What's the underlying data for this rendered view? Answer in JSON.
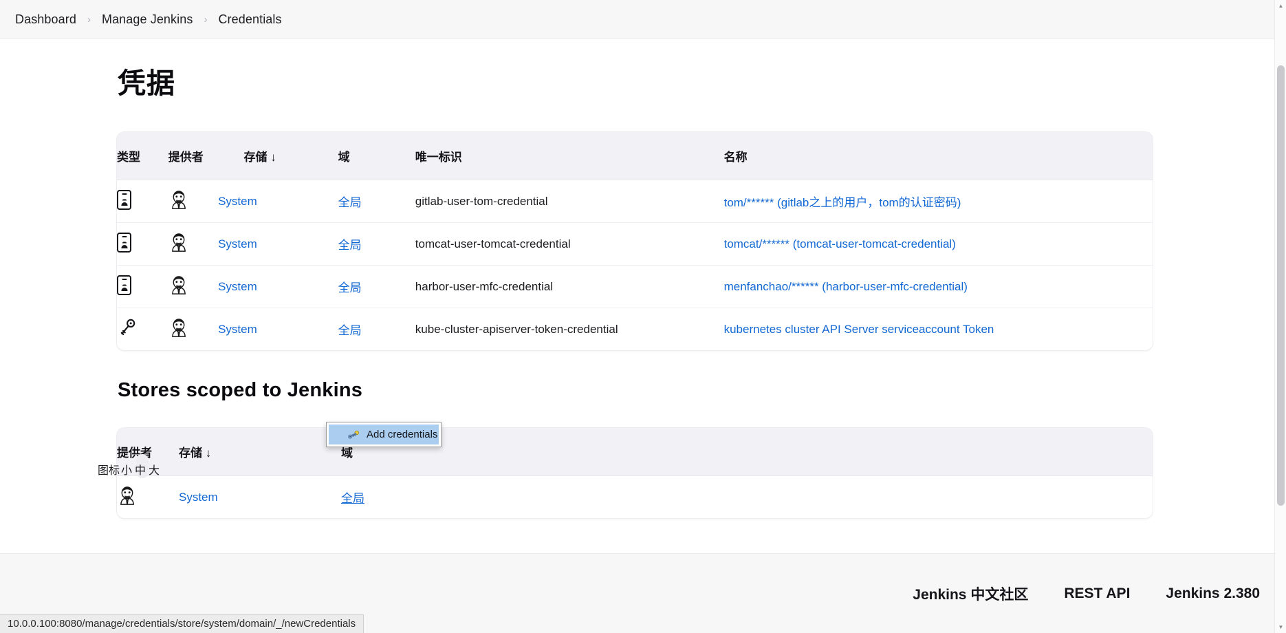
{
  "breadcrumb": {
    "items": [
      "Dashboard",
      "Manage Jenkins",
      "Credentials"
    ],
    "separator": "›"
  },
  "page": {
    "title": "凭据",
    "section_title": "Stores scoped to Jenkins"
  },
  "credentials_table": {
    "headers": {
      "type": "类型",
      "provider": "提供者",
      "store": "存储 ↓",
      "domain": "域",
      "id": "唯一标识",
      "name": "名称"
    },
    "rows": [
      {
        "type_icon": "id-card-icon",
        "provider_icon": "jenkins-butler-icon",
        "store": "System",
        "domain": "全局",
        "id": "gitlab-user-tom-credential",
        "name": "tom/****** (gitlab之上的用户，tom的认证密码)"
      },
      {
        "type_icon": "id-card-icon",
        "provider_icon": "jenkins-butler-icon",
        "store": "System",
        "domain": "全局",
        "id": "tomcat-user-tomcat-credential",
        "name": "tomcat/****** (tomcat-user-tomcat-credential)"
      },
      {
        "type_icon": "id-card-icon",
        "provider_icon": "jenkins-butler-icon",
        "store": "System",
        "domain": "全局",
        "id": "harbor-user-mfc-credential",
        "name": "menfanchao/****** (harbor-user-mfc-credential)"
      },
      {
        "type_icon": "key-icon",
        "provider_icon": "jenkins-butler-icon",
        "store": "System",
        "domain": "全局",
        "id": "kube-cluster-apiserver-token-credential",
        "name": "kubernetes cluster API Server serviceaccount Token"
      }
    ]
  },
  "stores_table": {
    "headers": {
      "provider": "提供者",
      "store": "存储 ↓",
      "domain": "域"
    },
    "rows": [
      {
        "provider_icon": "jenkins-butler-icon",
        "store": "System",
        "domain": "全局"
      }
    ]
  },
  "dropdown": {
    "visible": true,
    "items": [
      {
        "label": "Add credentials",
        "icon": "key-icon",
        "highlighted": true
      }
    ]
  },
  "icon_size": {
    "label": "图标",
    "options": [
      "小",
      "中",
      "大"
    ],
    "selected": "中"
  },
  "status_bar": {
    "url": "10.0.0.100:8080/manage/credentials/store/system/domain/_/newCredentials"
  },
  "footer": {
    "links": [
      "Jenkins 中文社区",
      "REST API",
      "Jenkins 2.380"
    ]
  },
  "colors": {
    "link": "#1268d3",
    "header_bg": "#f2f2f6",
    "chrome_bg": "#f7f7f8",
    "menu_highlight": "#aacdf0"
  }
}
